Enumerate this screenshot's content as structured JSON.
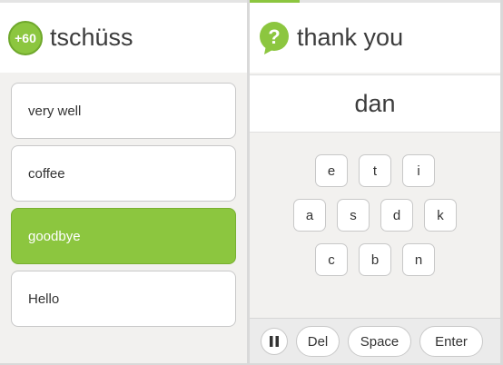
{
  "left_screen": {
    "progress_fraction": 0.0,
    "badge_label": "+60",
    "prompt_word": "tschüss",
    "choices": [
      {
        "label": "very well",
        "selected": false
      },
      {
        "label": "coffee",
        "selected": false
      },
      {
        "label": "goodbye",
        "selected": true
      },
      {
        "label": "Hello",
        "selected": false
      }
    ]
  },
  "right_screen": {
    "progress_fraction": 0.2,
    "prompt_word": "thank you",
    "answer_text": "dan",
    "keyboard_rows": [
      [
        "e",
        "t",
        "i"
      ],
      [
        "a",
        "s",
        "d",
        "k"
      ],
      [
        "c",
        "b",
        "n"
      ]
    ],
    "pause_icon": "pause-icon",
    "del_label": "Del",
    "space_label": "Space",
    "enter_label": "Enter"
  },
  "colors": {
    "accent_green": "#8cc63f",
    "background": "#f2f1ef"
  }
}
